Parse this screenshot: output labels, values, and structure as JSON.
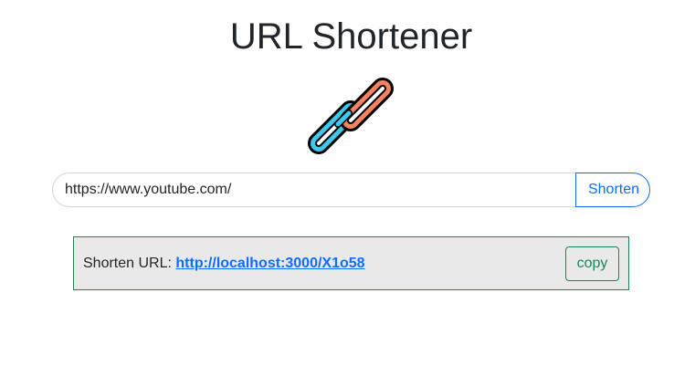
{
  "header": {
    "title": "URL Shortener",
    "logo_icon": "link-chain-icon"
  },
  "form": {
    "url_value": "https://www.youtube.com/",
    "shorten_label": "Shorten"
  },
  "result": {
    "label": "Shorten URL: ",
    "short_url": "http://localhost:3000/X1o58",
    "copy_label": "copy"
  },
  "colors": {
    "primary": "#0d6efd",
    "success": "#198754",
    "chain_orange": "#f4845f",
    "chain_blue": "#3ec8ec",
    "result_background": "#e9e9e9"
  }
}
